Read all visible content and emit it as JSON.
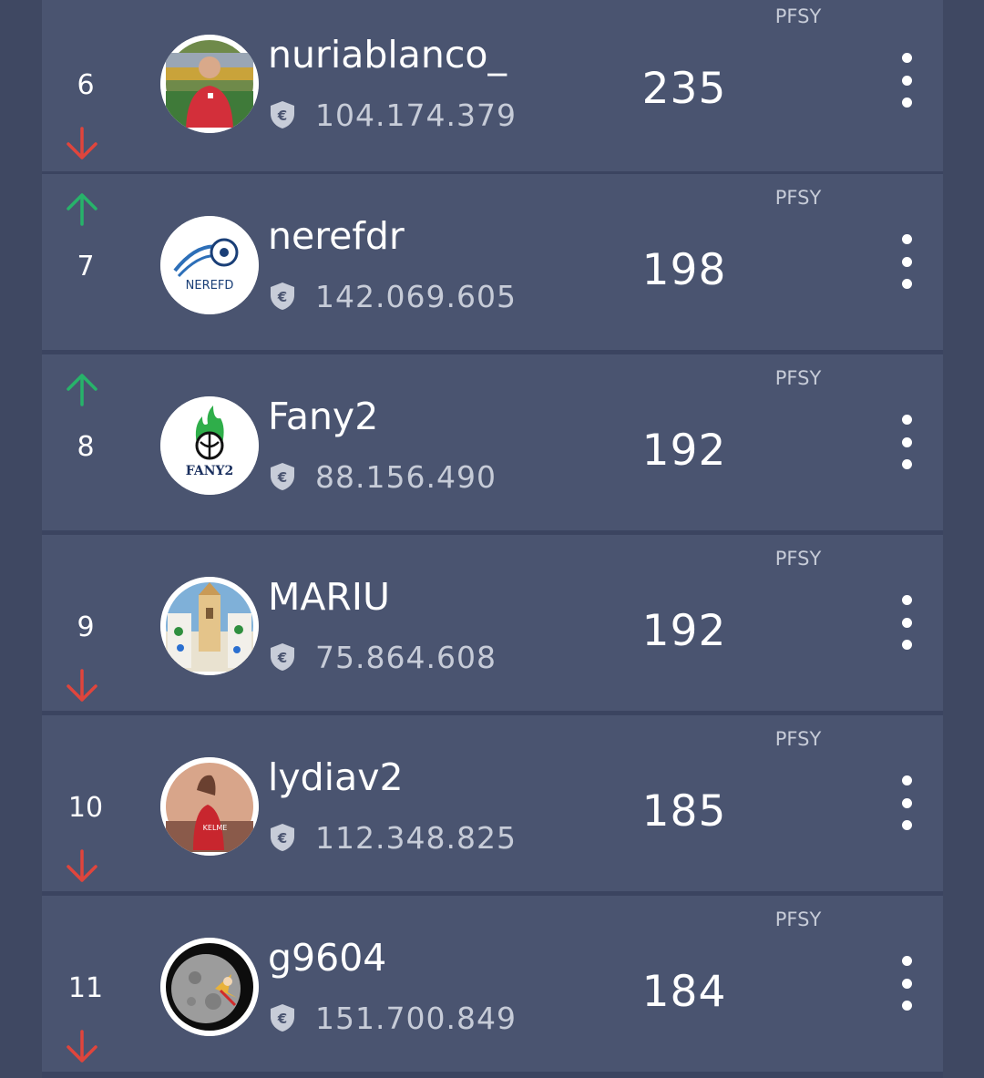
{
  "league_tag": "PFSY",
  "rows": [
    {
      "rank": "6",
      "trend": "down",
      "name": "nuriablanco_",
      "money": "104.174.379",
      "points": "235",
      "tag": "PFSY",
      "avatar": "coach-photo"
    },
    {
      "rank": "7",
      "trend": "up",
      "name": "nerefdr",
      "money": "142.069.605",
      "points": "198",
      "tag": "PFSY",
      "avatar": "nerefd-logo",
      "avatar_text": "NEREFD"
    },
    {
      "rank": "8",
      "trend": "up",
      "name": "Fany2",
      "money": "88.156.490",
      "points": "192",
      "tag": "PFSY",
      "avatar": "fany2-logo",
      "avatar_text": "FANY2"
    },
    {
      "rank": "9",
      "trend": "down",
      "name": "MARIU",
      "money": "75.864.608",
      "points": "192",
      "tag": "PFSY",
      "avatar": "church-photo"
    },
    {
      "rank": "10",
      "trend": "down",
      "name": "lydiav2",
      "money": "112.348.825",
      "points": "185",
      "tag": "PFSY",
      "avatar": "player-photo",
      "avatar_text": "KELME"
    },
    {
      "rank": "11",
      "trend": "down",
      "name": "g9604",
      "money": "151.700.849",
      "points": "184",
      "tag": "PFSY",
      "avatar": "moon-photo"
    }
  ],
  "colors": {
    "up": "#27b36a",
    "down": "#e0453c",
    "row_bg": "#4a5470",
    "page_bg": "#3f4862"
  }
}
